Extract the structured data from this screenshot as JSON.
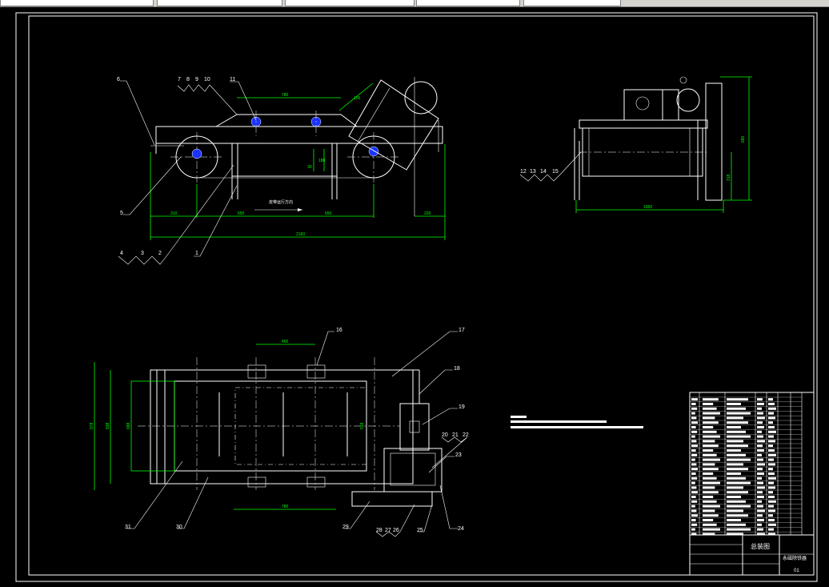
{
  "drawing": {
    "title_block": {
      "drawing_title": "总装图",
      "product_name": "永磁除铁器",
      "sheet_no": "01"
    },
    "front_view": {
      "part_labels": [
        "6",
        "7",
        "8",
        "9",
        "10",
        "11",
        "5",
        "4",
        "3",
        "2",
        "1"
      ],
      "dims": {
        "top_span": "780",
        "length_total": "2160",
        "left_seg": "310",
        "mid_left": "650",
        "mid_right": "650",
        "right_seg": "220",
        "height_small": "30",
        "height_small2": "180",
        "incline": "155"
      },
      "annotation": "皮带运行方向"
    },
    "side_view": {
      "part_labels": [
        "12",
        "13",
        "14",
        "15"
      ],
      "dims": {
        "width": "1050",
        "height_total": "680",
        "height_low": "318"
      }
    },
    "plan_view": {
      "part_labels": [
        "16",
        "17",
        "18",
        "19",
        "20",
        "21",
        "22",
        "23",
        "24",
        "25",
        "26",
        "27",
        "28",
        "29",
        "30",
        "31"
      ],
      "dims": {
        "top_width": "460",
        "bottom_width": "780",
        "overall_height": "978",
        "inner_height": "838",
        "inner_height2": "688",
        "right_height": "518"
      }
    }
  }
}
